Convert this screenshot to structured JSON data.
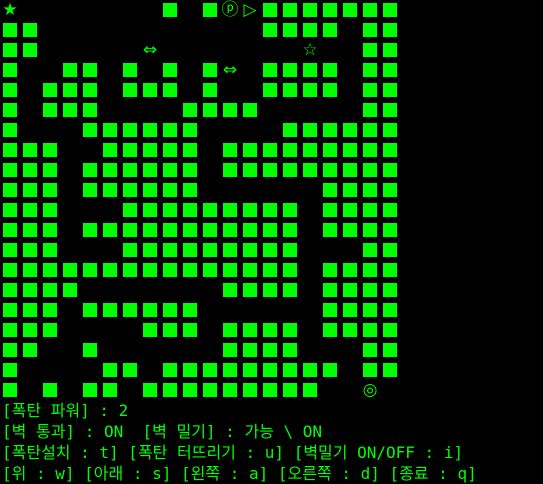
{
  "colors": {
    "background": "#000000",
    "wall": "#00ff00",
    "text": "#00ff00"
  },
  "legend": {
    "W": "wall",
    "S": "goal-star-filled",
    "s": "item-star-outline",
    "P": "player-p",
    ">": "direction-arrow",
    "H": "push-arrow-horizontal",
    "O": "exit-target",
    ".": "empty"
  },
  "symbols": {
    "S": "★",
    "s": "☆",
    "P": "ⓟ",
    ">": "▷",
    "H": "⇔",
    "O": "◎"
  },
  "maze_rows": [
    "S.......W.WP>WWWWWWW",
    "WW...........WWWW.WW",
    "WW.....H.......s..WW",
    "W..WW.W.W.WH.WWWW.WW",
    "W.WWW.WWW.W..WWWW.WW",
    "W.WWW....WWWW.....WW",
    "W...WWWWWW....WWWWWW",
    "WWW..WWWWW.WWWWWWWWW",
    "WWW.WWWWWW.WWWWWWWWW",
    "WWW.WWWWWW......WWWW",
    "WWW...WWWWWWWWW.WWWW",
    "WWW.WWWWWWWWWWW.WWWW",
    "WWW...WWWWWWWWW...WW",
    "WWWWWWWWWWWWWWW.WWWW",
    "WWWW.......WWWW.WWWW",
    "WWW.WWWWWW......WWWW",
    "WWW....WWW.WWWW.WWWW",
    "WW..W......WWWW...WW",
    "W....WW.WWWWWWWWW.WW",
    "W.W.WW.WWWWWWWWW..O."
  ],
  "status": {
    "line1": "[폭탄 파워] : 2",
    "line2": "[벽 통과] : ON  [벽 밀기] : 가능 \\ ON",
    "line3": "[폭탄설치 : t] [폭탄 터뜨리기 : u] [벽밀기 ON/OFF : i]",
    "line4": "[위 : w] [아래 : s] [왼쪽 : a] [오른쪽 : d] [종료 : q]"
  }
}
